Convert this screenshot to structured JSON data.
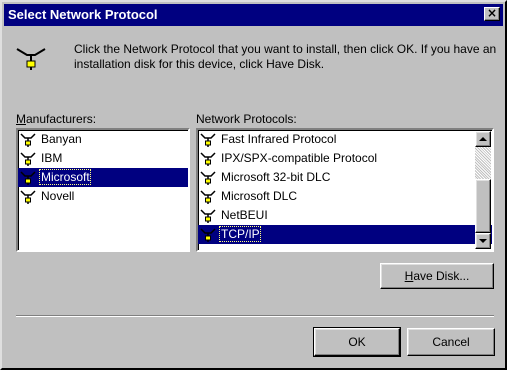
{
  "window": {
    "title": "Select Network Protocol",
    "close_glyph": "×"
  },
  "intro_text": "Click the Network Protocol that you want to install, then click OK. If you have an installation disk for this device, click Have Disk.",
  "manufacturers": {
    "label_accel": "M",
    "label_rest": "anufacturers:",
    "items": [
      {
        "label": "Banyan",
        "selected": false
      },
      {
        "label": "IBM",
        "selected": false
      },
      {
        "label": "Microsoft",
        "selected": true
      },
      {
        "label": "Novell",
        "selected": false
      }
    ]
  },
  "protocols": {
    "label": "Network Protocols:",
    "items": [
      {
        "label": "Fast Infrared Protocol",
        "selected": false
      },
      {
        "label": "IPX/SPX-compatible Protocol",
        "selected": false
      },
      {
        "label": "Microsoft 32-bit DLC",
        "selected": false
      },
      {
        "label": "Microsoft DLC",
        "selected": false
      },
      {
        "label": "NetBEUI",
        "selected": false
      },
      {
        "label": "TCP/IP",
        "selected": true
      }
    ]
  },
  "buttons": {
    "have_disk_accel": "H",
    "have_disk_rest": "ave Disk...",
    "ok": "OK",
    "cancel": "Cancel"
  },
  "colors": {
    "selection": "#000080",
    "titlebar": "#000080",
    "face": "#c0c0c0"
  },
  "icons": {
    "list_item": "network-protocol-icon",
    "header": "network-plug-icon"
  }
}
